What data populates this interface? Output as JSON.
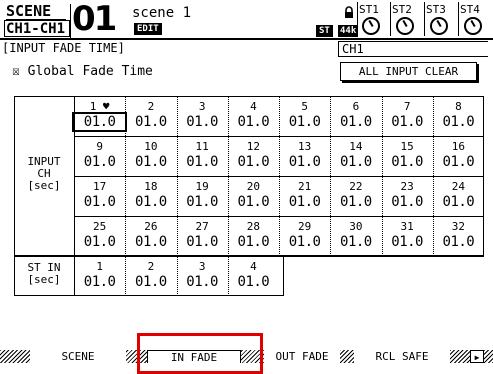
{
  "header": {
    "scene_label": "SCENE",
    "channel_label": "CH1-CH1",
    "scene_number": "01",
    "scene_name": "scene 1",
    "edit_badge": "EDIT",
    "st_badge": "ST",
    "fs_badge": "44k",
    "st_knobs": [
      "ST1",
      "ST2",
      "ST3",
      "ST4"
    ]
  },
  "page": {
    "title": "[INPUT FADE TIME]",
    "selected_channel": "CH1",
    "global_fade_label": "☒ Global Fade Time",
    "all_input_clear_label": "ALL INPUT CLEAR"
  },
  "input_ch": {
    "label_line1": "INPUT",
    "label_line2": "CH",
    "label_line3": "[sec]",
    "channels": [
      {
        "num": "1",
        "val": "01.0"
      },
      {
        "num": "2",
        "val": "01.0"
      },
      {
        "num": "3",
        "val": "01.0"
      },
      {
        "num": "4",
        "val": "01.0"
      },
      {
        "num": "5",
        "val": "01.0"
      },
      {
        "num": "6",
        "val": "01.0"
      },
      {
        "num": "7",
        "val": "01.0"
      },
      {
        "num": "8",
        "val": "01.0"
      },
      {
        "num": "9",
        "val": "01.0"
      },
      {
        "num": "10",
        "val": "01.0"
      },
      {
        "num": "11",
        "val": "01.0"
      },
      {
        "num": "12",
        "val": "01.0"
      },
      {
        "num": "13",
        "val": "01.0"
      },
      {
        "num": "14",
        "val": "01.0"
      },
      {
        "num": "15",
        "val": "01.0"
      },
      {
        "num": "16",
        "val": "01.0"
      },
      {
        "num": "17",
        "val": "01.0"
      },
      {
        "num": "18",
        "val": "01.0"
      },
      {
        "num": "19",
        "val": "01.0"
      },
      {
        "num": "20",
        "val": "01.0"
      },
      {
        "num": "21",
        "val": "01.0"
      },
      {
        "num": "22",
        "val": "01.0"
      },
      {
        "num": "23",
        "val": "01.0"
      },
      {
        "num": "24",
        "val": "01.0"
      },
      {
        "num": "25",
        "val": "01.0"
      },
      {
        "num": "26",
        "val": "01.0"
      },
      {
        "num": "27",
        "val": "01.0"
      },
      {
        "num": "28",
        "val": "01.0"
      },
      {
        "num": "29",
        "val": "01.0"
      },
      {
        "num": "30",
        "val": "01.0"
      },
      {
        "num": "31",
        "val": "01.0"
      },
      {
        "num": "32",
        "val": "01.0"
      }
    ]
  },
  "st_in": {
    "label_line1": "ST IN",
    "label_line2": "[sec]",
    "channels": [
      {
        "num": "1",
        "val": "01.0"
      },
      {
        "num": "2",
        "val": "01.0"
      },
      {
        "num": "3",
        "val": "01.0"
      },
      {
        "num": "4",
        "val": "01.0"
      }
    ]
  },
  "tabs": [
    "SCENE",
    "IN FADE",
    "OUT FADE",
    "RCL SAFE"
  ],
  "tab_next": "▶",
  "highlight_color": "#e00000"
}
